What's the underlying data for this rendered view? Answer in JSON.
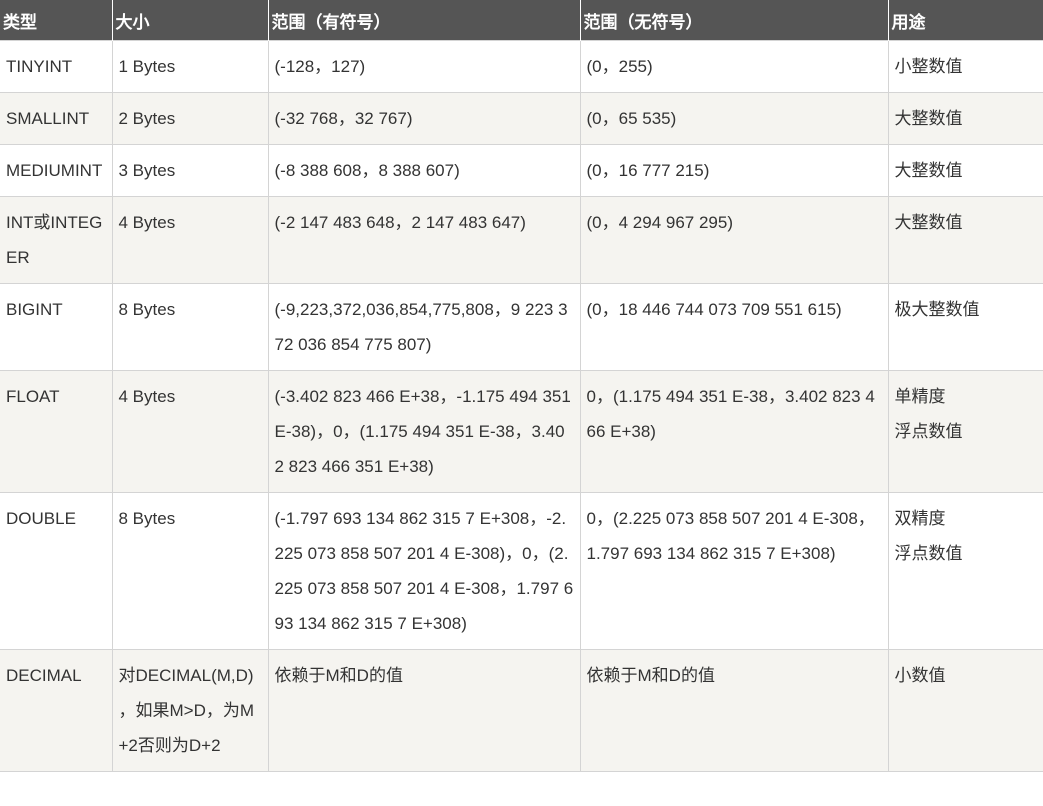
{
  "table": {
    "headers": [
      "类型",
      "大小",
      "范围（有符号）",
      "范围（无符号）",
      "用途"
    ],
    "rows": [
      [
        "TINYINT",
        "1 Bytes",
        "(-128，127)",
        "(0，255)",
        "小整数值"
      ],
      [
        "SMALLINT",
        "2 Bytes",
        "(-32 768，32 767)",
        "(0，65 535)",
        "大整数值"
      ],
      [
        "MEDIUMINT",
        "3 Bytes",
        "(-8 388 608，8 388 607)",
        "(0，16 777 215)",
        "大整数值"
      ],
      [
        "INT或INTEGER",
        "4 Bytes",
        "(-2 147 483 648，2 147 483 647)",
        "(0，4 294 967 295)",
        "大整数值"
      ],
      [
        "BIGINT",
        "8 Bytes",
        "(-9,223,372,036,854,775,808，9 223 372 036 854 775 807)",
        "(0，18 446 744 073 709 551 615)",
        "极大整数值"
      ],
      [
        "FLOAT",
        "4 Bytes",
        "(-3.402 823 466 E+38，-1.175 494 351 E-38)，0，(1.175 494 351 E-38，3.402 823 466 351 E+38)",
        "0，(1.175 494 351 E-38，3.402 823 466 E+38)",
        "单精度\n浮点数值"
      ],
      [
        "DOUBLE",
        "8 Bytes",
        "(-1.797 693 134 862 315 7 E+308，-2.225 073 858 507 201 4 E-308)，0，(2.225 073 858 507 201 4 E-308，1.797 693 134 862 315 7 E+308)",
        "0，(2.225 073 858 507 201 4 E-308，1.797 693 134 862 315 7 E+308)",
        "双精度\n浮点数值"
      ],
      [
        "DECIMAL",
        "对DECIMAL(M,D) ，如果M>D，为M+2否则为D+2",
        "依赖于M和D的值",
        "依赖于M和D的值",
        "小数值"
      ]
    ]
  }
}
